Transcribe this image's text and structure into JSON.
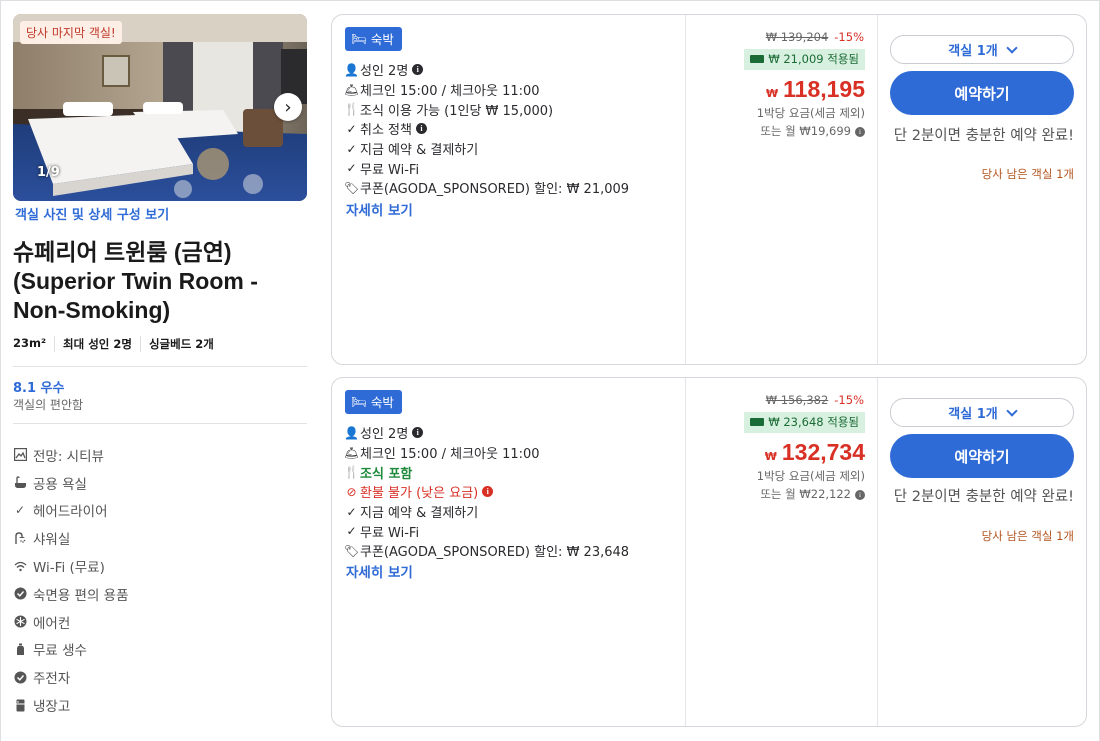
{
  "room": {
    "badge": "당사 마지막 객실!",
    "photo_counter": "1/9",
    "photo_link": "객실 사진 및 상세 구성 보기",
    "title": "슈페리어 트윈룸 (금연) (Superior Twin Room - Non-Smoking)",
    "specs": [
      "23m²",
      "최대 성인 2명",
      "싱글베드 2개"
    ],
    "score": "8.1 우수",
    "score_sub": "객실의 편안함",
    "amenities": [
      {
        "icon": "view-icon",
        "label": "전망: 시티뷰"
      },
      {
        "icon": "bathtub-icon",
        "label": "공용 욕실"
      },
      {
        "icon": "check-icon",
        "label": "헤어드라이어"
      },
      {
        "icon": "shower-icon",
        "label": "샤워실"
      },
      {
        "icon": "wifi-icon",
        "label": "Wi-Fi (무료)"
      },
      {
        "icon": "toiletries-icon",
        "label": "숙면용 편의 용품"
      },
      {
        "icon": "aircon-icon",
        "label": "에어컨"
      },
      {
        "icon": "water-icon",
        "label": "무료 생수"
      },
      {
        "icon": "kettle-icon",
        "label": "주전자"
      },
      {
        "icon": "fridge-icon",
        "label": "냉장고"
      }
    ]
  },
  "offers": [
    {
      "stay_label": "숙박",
      "features": {
        "guests": "성인 2명",
        "checkin": "체크인 15:00 / 체크아웃 11:00",
        "breakfast": "조식 이용 가능 (1인당 ₩ 15,000)",
        "cancel": "취소 정책",
        "pay": "지금 예약 & 결제하기",
        "wifi": "무료 Wi-Fi",
        "coupon": "쿠폰(AGODA_SPONSORED) 할인: ₩ 21,009"
      },
      "more": "자세히 보기",
      "old_price": "₩ 139,204",
      "discount": "-15%",
      "coupon_applied": "₩ 21,009 적용됨",
      "currency": "₩",
      "price": "118,195",
      "price_note": "1박당 요금(세금 제외)",
      "monthly": "또는 월 ₩19,699",
      "room_select": "객실 1개",
      "book": "예약하기",
      "urgency": "단 2분이면 충분한 예약 완료!",
      "left": "당사 남은 객실 1개"
    },
    {
      "stay_label": "숙박",
      "features": {
        "guests": "성인 2명",
        "checkin": "체크인 15:00 / 체크아웃 11:00",
        "breakfast": "조식 포함",
        "refund": "환불 불가 (낮은 요금)",
        "pay": "지금 예약 & 결제하기",
        "wifi": "무료 Wi-Fi",
        "coupon": "쿠폰(AGODA_SPONSORED) 할인: ₩ 23,648"
      },
      "more": "자세히 보기",
      "old_price": "₩ 156,382",
      "discount": "-15%",
      "coupon_applied": "₩ 23,648 적용됨",
      "currency": "₩",
      "price": "132,734",
      "price_note": "1박당 요금(세금 제외)",
      "monthly": "또는 월 ₩22,122",
      "room_select": "객실 1개",
      "book": "예약하기",
      "urgency": "단 2분이면 충분한 예약 완료!",
      "left": "당사 남은 객실 1개"
    }
  ]
}
